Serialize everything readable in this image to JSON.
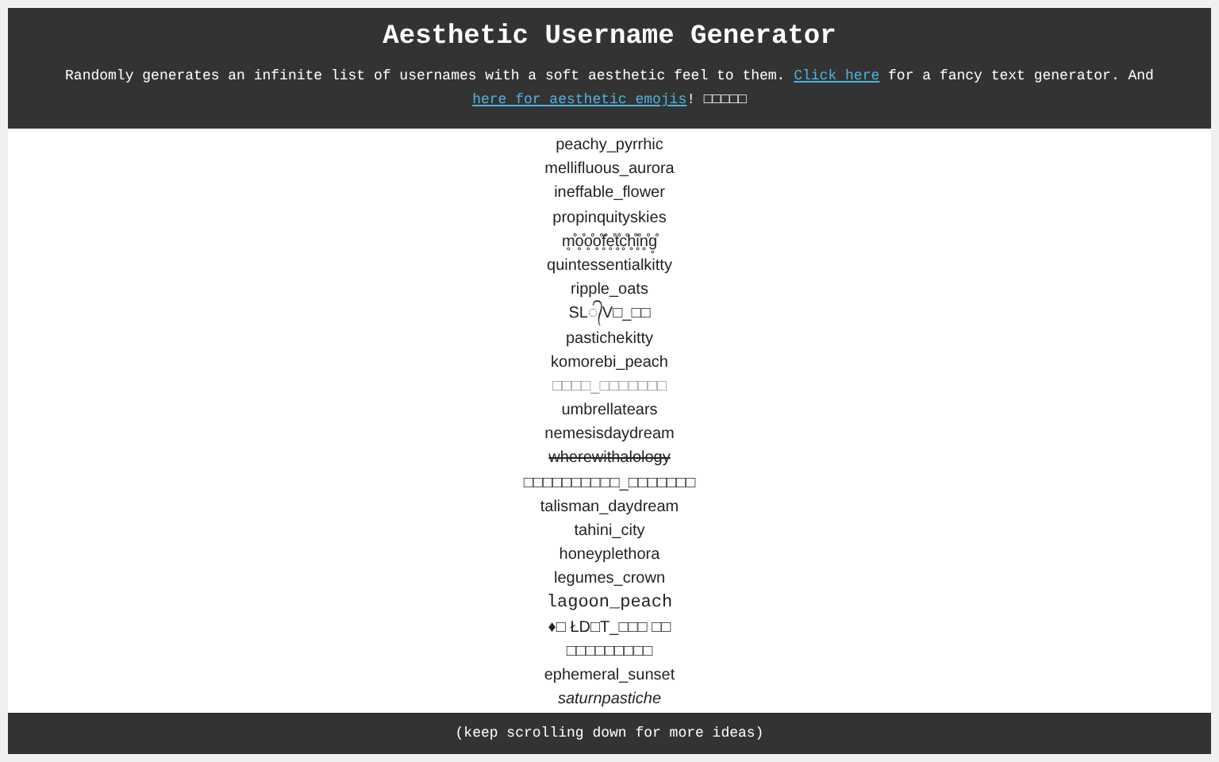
{
  "header": {
    "title": "Aesthetic Username Generator",
    "intro": {
      "before": "Randomly generates an infinite list of usernames with a soft aesthetic feel to them. ",
      "link1": "Click here",
      "middle": " for a fancy text generator. And ",
      "link2": "here for aesthetic emojis",
      "after": "! □□□□□"
    }
  },
  "usernames": [
    {
      "text": "peachy_pyrrhic",
      "kind": "plain"
    },
    {
      "text": "mellifluous_aurora",
      "kind": "plain"
    },
    {
      "text": "ineffable_flower",
      "kind": "plain"
    },
    {
      "text": "propinquityskies",
      "kind": "plain"
    },
    {
      "text": "m̥̊o̥̊o̥̊o̥̊f̥̊e̥̊t̥̊c̥̊h̥̊i̥̊n̥̊g̥̊",
      "kind": "plain"
    },
    {
      "text": "quintessentialkitty",
      "kind": "plain"
    },
    {
      "text": "ripple_oats",
      "kind": "plain"
    },
    {
      "text": "SL᭄V□_□□",
      "kind": "plain"
    },
    {
      "text": "pastichekitty",
      "kind": "plain"
    },
    {
      "text": "komorebi_peach",
      "kind": "plain"
    },
    {
      "text": "□□□□_□□□□□□□",
      "kind": "faint"
    },
    {
      "text": "umbrellatears",
      "kind": "plain"
    },
    {
      "text": "nemesisdaydream",
      "kind": "plain"
    },
    {
      "text": "wherewithalology",
      "kind": "strike"
    },
    {
      "text": "□□□□□□□□□□_□□□□□□□",
      "kind": "plain"
    },
    {
      "text": "talisman_daydream",
      "kind": "plain"
    },
    {
      "text": "tahini_city",
      "kind": "plain"
    },
    {
      "text": "honeyplethora",
      "kind": "plain"
    },
    {
      "text": "legumes_crown",
      "kind": "plain"
    },
    {
      "text": "lagoon_peach",
      "kind": "mono"
    },
    {
      "text": "♦□ ŁD□T_□□□ □□",
      "kind": "plain"
    },
    {
      "text": "□□□□□□□□□",
      "kind": "plain"
    },
    {
      "text": "ephemeral_sunset",
      "kind": "plain"
    },
    {
      "text": "saturnpastiche",
      "kind": "italic"
    }
  ],
  "footer": {
    "text": "(keep scrolling down for more ideas)"
  }
}
